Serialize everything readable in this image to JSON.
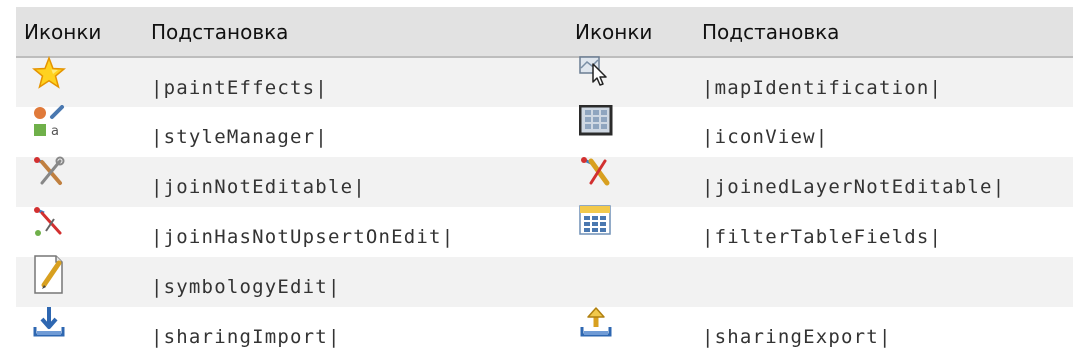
{
  "table": {
    "headers": [
      "Иконки",
      "Подстановка",
      "Иконки",
      "Подстановка"
    ],
    "rows": [
      {
        "left": {
          "icon": "star-icon",
          "code": "|paintEffects|"
        },
        "right": {
          "icon": "map-identification-icon",
          "code": "|mapIdentification|"
        }
      },
      {
        "left": {
          "icon": "style-manager-icon",
          "code": "|styleManager|"
        },
        "right": {
          "icon": "icon-view-icon",
          "code": "|iconView|"
        }
      },
      {
        "left": {
          "icon": "join-not-editable-icon",
          "code": "|joinNotEditable|"
        },
        "right": {
          "icon": "joined-layer-not-editable-icon",
          "code": "|joinedLayerNotEditable|"
        }
      },
      {
        "left": {
          "icon": "join-has-not-upsert-icon",
          "code": "|joinHasNotUpsertOnEdit|"
        },
        "right": {
          "icon": "filter-table-fields-icon",
          "code": "|filterTableFields|"
        }
      },
      {
        "left": {
          "icon": "symbology-edit-icon",
          "code": "|symbologyEdit|"
        },
        "right": {
          "icon": "",
          "code": ""
        }
      },
      {
        "left": {
          "icon": "sharing-import-icon",
          "code": "|sharingImport|"
        },
        "right": {
          "icon": "sharing-export-icon",
          "code": "|sharingExport|"
        }
      }
    ]
  }
}
